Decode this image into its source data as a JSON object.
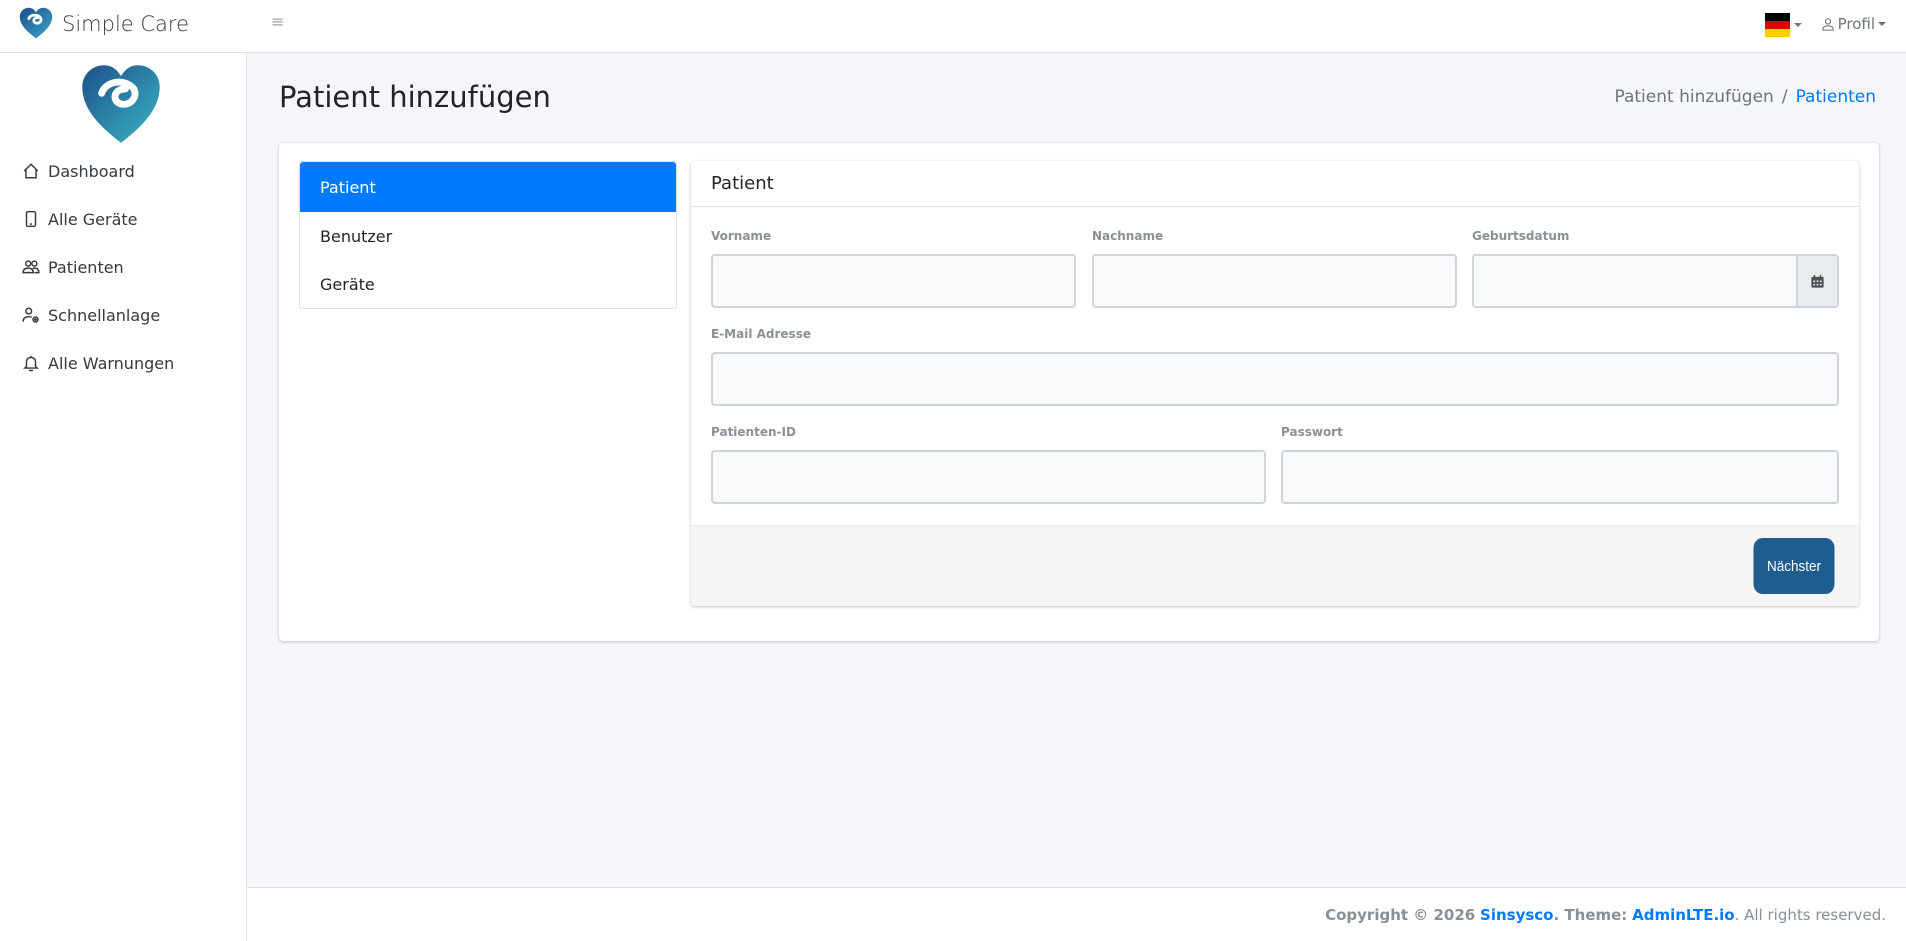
{
  "brand": {
    "name": "Simple Care"
  },
  "topbar": {
    "menu_icon": "hamburger-icon",
    "language": {
      "flag": "de",
      "colors": [
        "#000000",
        "#dd0000",
        "#ffce00"
      ]
    },
    "profile_label": "Profil"
  },
  "sidebar": {
    "items": [
      {
        "label": "Dashboard",
        "icon": "house-icon"
      },
      {
        "label": "Alle Geräte",
        "icon": "phone-icon"
      },
      {
        "label": "Patienten",
        "icon": "people-icon"
      },
      {
        "label": "Schnellanlage",
        "icon": "person-gear-icon"
      },
      {
        "label": "Alle Warnungen",
        "icon": "bell-icon"
      }
    ]
  },
  "page": {
    "title": "Patient hinzufügen",
    "breadcrumb": {
      "current": "Patient hinzufügen",
      "separator": "/",
      "link": "Patienten"
    }
  },
  "steps": [
    {
      "label": "Patient",
      "active": true
    },
    {
      "label": "Benutzer",
      "active": false
    },
    {
      "label": "Geräte",
      "active": false
    }
  ],
  "form": {
    "header": "Patient",
    "fields": {
      "vorname": {
        "label": "Vorname",
        "value": ""
      },
      "nachname": {
        "label": "Nachname",
        "value": ""
      },
      "geburtsdatum": {
        "label": "Geburtsdatum",
        "value": ""
      },
      "email": {
        "label": "E-Mail Adresse",
        "value": ""
      },
      "patienten_id": {
        "label": "Patienten-ID",
        "value": ""
      },
      "passwort": {
        "label": "Passwort",
        "value": ""
      }
    },
    "next_label": "Nächster"
  },
  "footer": {
    "copyright": "Copyright © 2026",
    "company": "Sinsysco",
    "theme_label": ". Theme:",
    "theme_link": "AdminLTE.io",
    "rights": ". All rights reserved."
  },
  "colors": {
    "accent": "#007bff",
    "button": "#1f5c8f",
    "background": "#f4f6f9"
  }
}
